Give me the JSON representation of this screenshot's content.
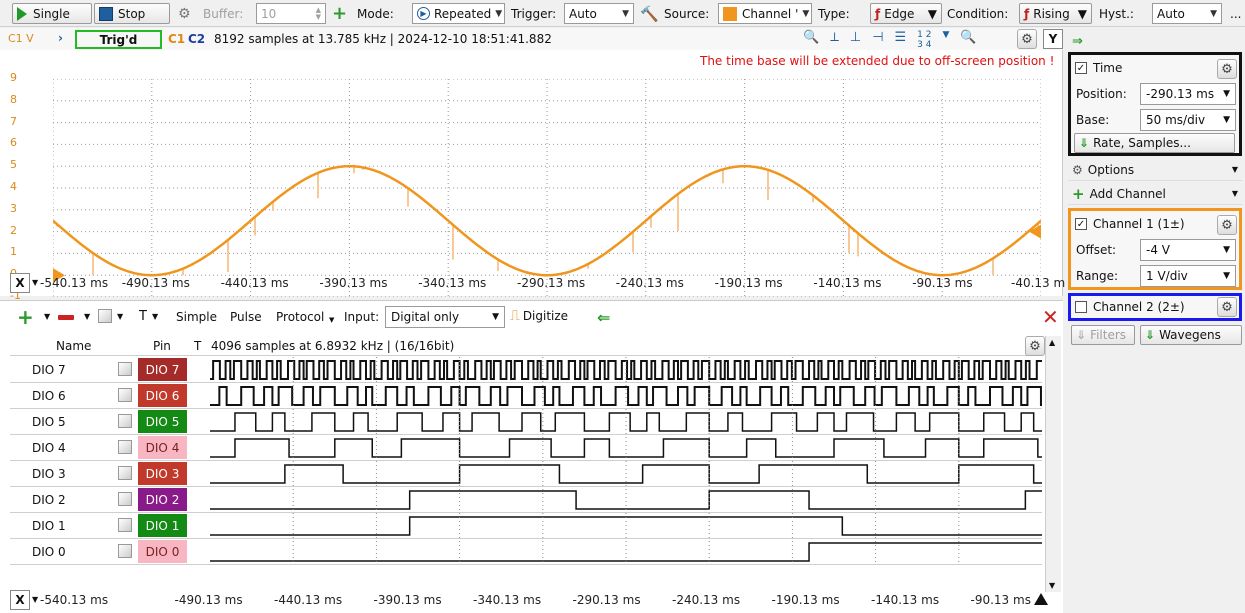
{
  "toolbar": {
    "single": "Single",
    "stop": "Stop",
    "buffer_label": "Buffer:",
    "buffer_value": "10",
    "mode_label": "Mode:",
    "mode_value": "Repeated",
    "trigger_label": "Trigger:",
    "trigger_value": "Auto",
    "source_label": "Source:",
    "source_value": "Channel '",
    "type_label": "Type:",
    "type_value": "Edge",
    "condition_label": "Condition:",
    "condition_value": "Rising",
    "hyst_label": "Hyst.:",
    "hyst_value": "Auto",
    "more": "..."
  },
  "scope": {
    "c1v_label": "C1 V",
    "trig_status": "Trig'd",
    "c1": "C1",
    "c2": "C2",
    "info": "8192 samples at 13.785 kHz  |  2024-12-10 18:51:41.882",
    "warning": "The time base will be extended due to off-screen position !",
    "y_btn": "Y",
    "x_btn": "X",
    "y_ticks": [
      "9",
      "8",
      "7",
      "6",
      "5",
      "4",
      "3",
      "2",
      "1",
      "0",
      "-1"
    ],
    "x_ticks": [
      "-540.13 ms",
      "-490.13 ms",
      "-440.13 ms",
      "-390.13 ms",
      "-340.13 ms",
      "-290.13 ms",
      "-240.13 ms",
      "-190.13 ms",
      "-140.13 ms",
      "-90.13 ms",
      "-40.13 m"
    ],
    "colors": {
      "ch1": "#f0961e",
      "trig_box": "#22bb22",
      "warning": "#e01010"
    }
  },
  "chart_data": {
    "type": "line",
    "series": [
      {
        "name": "C1",
        "color": "#f0961e"
      }
    ],
    "x_ticks": [
      "-540.13 ms",
      "-490.13 ms",
      "-440.13 ms",
      "-390.13 ms",
      "-340.13 ms",
      "-290.13 ms",
      "-240.13 ms",
      "-190.13 ms",
      "-140.13 ms",
      "-90.13 ms",
      "-40.13 m"
    ],
    "ylim": [
      -1,
      9
    ],
    "min_value": 0,
    "max_value": 5,
    "min_at": [
      "-490.13 ms",
      "-290.13 ms",
      "-90.13 ms"
    ],
    "max_at": [
      "-390.13 ms",
      "-190.13 ms"
    ]
  },
  "logic": {
    "tools": [
      "Simple",
      "Pulse",
      "Protocol"
    ],
    "input_label": "Input:",
    "input_value": "Digital only",
    "digitize": "Digitize",
    "col_name": "Name",
    "col_pin": "Pin",
    "col_t": "T",
    "info": "4096 samples at 6.8932 kHz |  (16/16bit)",
    "x_btn": "X",
    "x_ticks": [
      "-540.13 ms",
      "-490.13 ms",
      "-440.13 ms",
      "-390.13 ms",
      "-340.13 ms",
      "-290.13 ms",
      "-240.13 ms",
      "-190.13 ms",
      "-140.13 ms",
      "-90.13 ms",
      "-40.13 m"
    ],
    "rows": [
      {
        "name": "DIO 7",
        "pin": "DIO 7",
        "bg": "#a52a2a",
        "fg": "#ffffff",
        "period": 2
      },
      {
        "name": "DIO 6",
        "pin": "DIO 6",
        "bg": "#c0392b",
        "fg": "#ffffff",
        "period": 4
      },
      {
        "name": "DIO 5",
        "pin": "DIO 5",
        "bg": "#138a13",
        "fg": "#ffffff",
        "period": 8
      },
      {
        "name": "DIO 4",
        "pin": "DIO 4",
        "bg": "#f7b6c2",
        "fg": "#7a1f1f",
        "period": 16
      },
      {
        "name": "DIO 3",
        "pin": "DIO 3",
        "bg": "#c0392b",
        "fg": "#ffffff",
        "period": 32
      },
      {
        "name": "DIO 2",
        "pin": "DIO 2",
        "bg": "#8a1a8a",
        "fg": "#ffffff",
        "period": 64
      },
      {
        "name": "DIO 1",
        "pin": "DIO 1",
        "bg": "#138a13",
        "fg": "#ffffff",
        "period": 128
      },
      {
        "name": "DIO 0",
        "pin": "DIO 0",
        "bg": "#f7b6c2",
        "fg": "#7a1f1f",
        "period": 256
      }
    ]
  },
  "right": {
    "time_title": "Time",
    "position_label": "Position:",
    "position_value": "-290.13 ms",
    "base_label": "Base:",
    "base_value": "50 ms/div",
    "rate_btn": "Rate, Samples...",
    "options": "Options",
    "add_channel": "Add Channel",
    "ch1_title": "Channel 1 (1±)",
    "offset_label": "Offset:",
    "offset_value": "-4 V",
    "range_label": "Range:",
    "range_value": "1 V/div",
    "ch2_title": "Channel 2 (2±)",
    "filters": "Filters",
    "wavegens": "Wavegens"
  }
}
